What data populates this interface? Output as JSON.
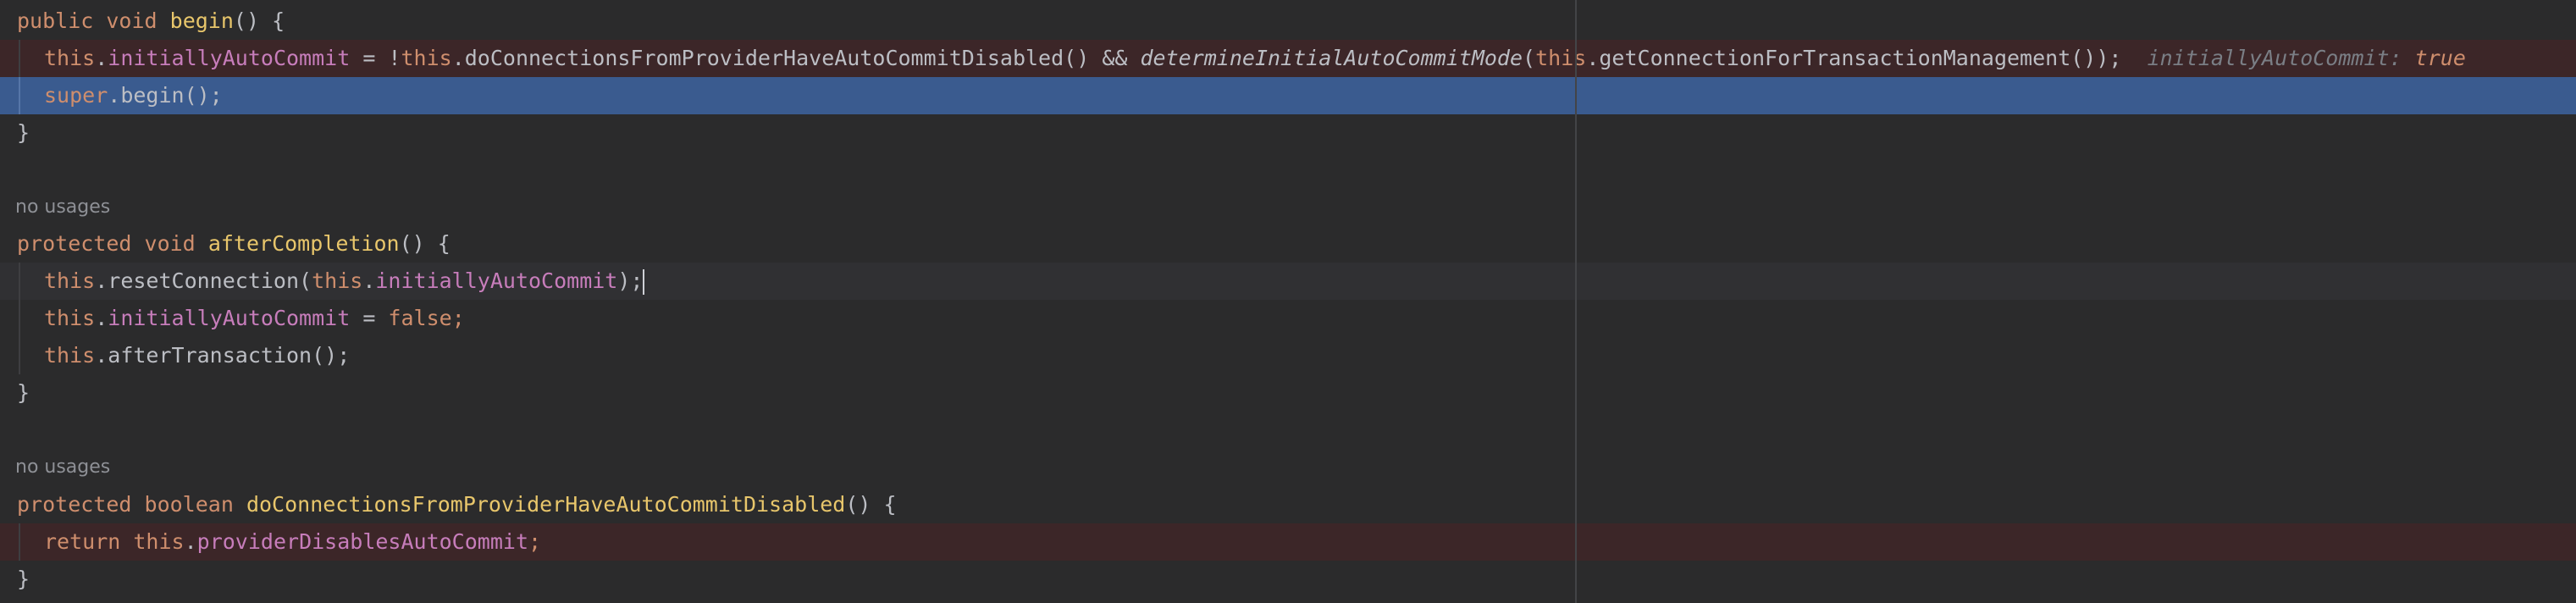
{
  "editor": {
    "language": "Java",
    "colors": {
      "background": "#2b2b2c",
      "text": "#bcbec4",
      "keyword": "#cf8e6d",
      "method_declaration": "#e8c66b",
      "field": "#c77dbb",
      "hint": "#7a7e85",
      "breakpoint_line": "#3c2628",
      "execution_line": "#3a5b8f",
      "caret_line": "#303033"
    },
    "m1": {
      "sig_kw1": "public",
      "sig_kw2": "void",
      "sig_name": "begin",
      "sig_rest": "() {",
      "l1_this1": "this",
      "l1_dot1": ".",
      "l1_field": "initiallyAutoCommit",
      "l1_eq": " = !",
      "l1_this2": "this",
      "l1_call1": ".doConnectionsFromProviderHaveAutoCommitDisabled() && ",
      "l1_static": "determineInitialAutoCommitMode",
      "l1_paren": "(",
      "l1_this3": "this",
      "l1_call2": ".getConnectionForTransactionManagement());",
      "l1_hint_label": "initiallyAutoCommit:",
      "l1_hint_value": "true",
      "l2_super": "super",
      "l2_call": ".begin();",
      "close": "}"
    },
    "m2": {
      "usages": "no usages",
      "sig_kw1": "protected",
      "sig_kw2": "void",
      "sig_name": "afterCompletion",
      "sig_rest": "() {",
      "l1_this1": "this",
      "l1_call": ".resetConnection(",
      "l1_this2": "this",
      "l1_dot": ".",
      "l1_field": "initiallyAutoCommit",
      "l1_end": ");",
      "l2_this": "this",
      "l2_dot": ".",
      "l2_field": "initiallyAutoCommit",
      "l2_eq": " = ",
      "l2_false": "false",
      "l2_semi": ";",
      "l3_this": "this",
      "l3_call": ".afterTransaction();",
      "close": "}"
    },
    "m3": {
      "usages": "no usages",
      "sig_kw1": "protected",
      "sig_kw2": "boolean",
      "sig_name": "doConnectionsFromProviderHaveAutoCommitDisabled",
      "sig_rest": "() {",
      "l1_return": "return",
      "l1_this": "this",
      "l1_dot": ".",
      "l1_field": "providerDisablesAutoCommit",
      "l1_semi": ";",
      "close": "}"
    }
  }
}
